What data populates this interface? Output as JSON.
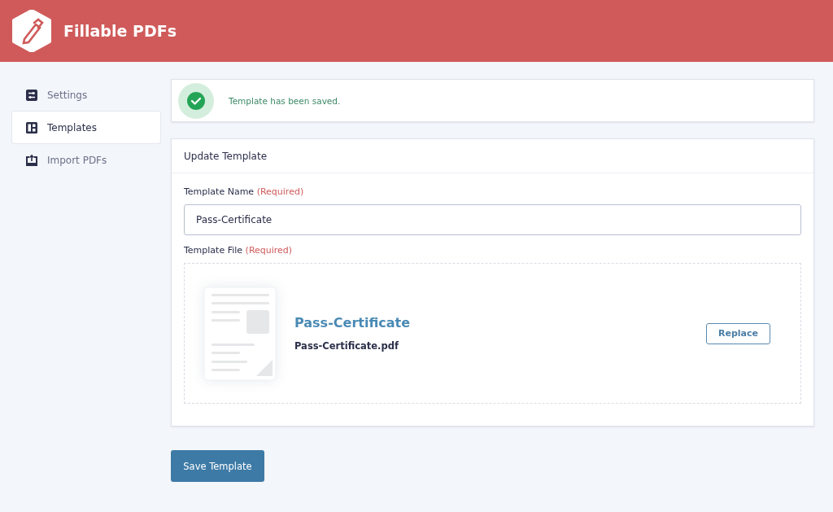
{
  "header": {
    "title": "Fillable PDFs"
  },
  "sidebar": {
    "items": [
      {
        "kind": "sliders",
        "label": "Settings",
        "selected": false
      },
      {
        "kind": "layout",
        "label": "Templates",
        "selected": true
      },
      {
        "kind": "upload",
        "label": "Import PDFs",
        "selected": false
      }
    ]
  },
  "notice": {
    "message": "Template has been saved."
  },
  "form": {
    "title": "Update Template",
    "name_field": {
      "label": "Template Name",
      "required": "(Required)",
      "value": "Pass-Certificate"
    },
    "file_field": {
      "label": "Template File",
      "required": "(Required)",
      "file_title": "Pass-Certificate",
      "file_name": "Pass-Certificate.pdf",
      "button": "Replace"
    }
  },
  "save_button": "Save Template"
}
